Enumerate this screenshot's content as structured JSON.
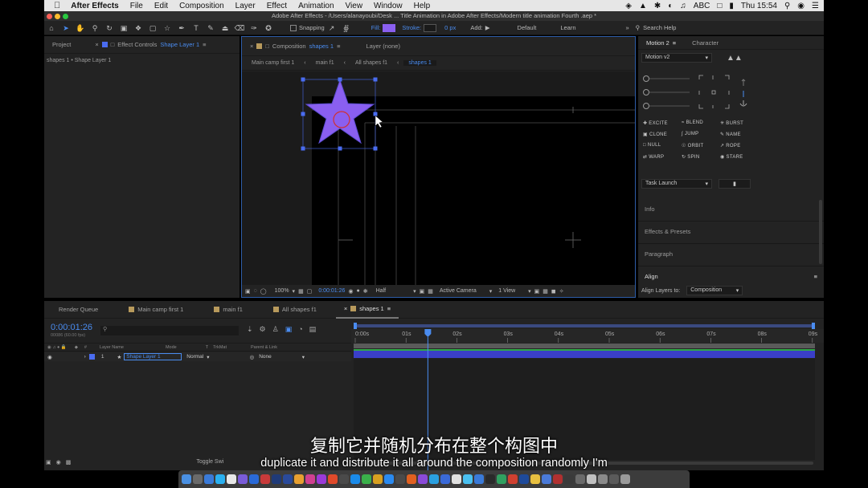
{
  "menubar": {
    "app": "After Effects",
    "items": [
      "File",
      "Edit",
      "Composition",
      "Layer",
      "Effect",
      "Animation",
      "View",
      "Window",
      "Help"
    ],
    "status": {
      "input": "ABC",
      "clock": "Thu 15:54"
    }
  },
  "window": {
    "title": "Adobe After Effects - /Users/alanayoubi/Desk ... Title Animation in Adobe After Effects/Modern title animation Fourth .aep *"
  },
  "toolbar": {
    "snapping": "Snapping",
    "fill_label": "Fill:",
    "fill_color": "#8a5ff0",
    "stroke_label": "Stroke:",
    "stroke_value": "0 px",
    "add_label": "Add:",
    "workspace_default": "Default",
    "workspace_learn": "Learn",
    "search_placeholder": "Search Help"
  },
  "project_panel": {
    "tab_project": "Project",
    "tab_effect_controls": "Effect Controls",
    "effect_layer": "Shape Layer 1",
    "breadcrumb": "shapes 1 • Shape Layer 1"
  },
  "comp_panel": {
    "tab_label": "Composition",
    "comp_name": "shapes 1",
    "layer_tab": "Layer (none)",
    "breadcrumbs": [
      "Main camp first 1",
      "main f1",
      "All shapes f1",
      "shapes 1"
    ],
    "footer": {
      "zoom": "100%",
      "timecode": "0:00:01:26",
      "resolution": "Half",
      "camera": "Active Camera",
      "views": "1 View"
    },
    "star_color": "#8a5ff0"
  },
  "motion_panel": {
    "tab_motion": "Motion 2",
    "tab_character": "Character",
    "version": "Motion v2",
    "effects": [
      [
        "EXCITE",
        "BLEND",
        "BURST"
      ],
      [
        "CLONE",
        "JUMP",
        "NAME"
      ],
      [
        "NULL",
        "ORBIT",
        "ROPE"
      ],
      [
        "WARP",
        "SPIN",
        "STARE"
      ]
    ],
    "task_launch": "Task Launch",
    "sections": [
      "Info",
      "Effects & Presets",
      "Paragraph",
      "Align"
    ],
    "align_layers_to_label": "Align Layers to:",
    "align_layers_to_value": "Composition"
  },
  "timeline": {
    "tabs": [
      "Render Queue",
      "Main camp first 1",
      "main f1",
      "All shapes f1",
      "shapes 1"
    ],
    "timecode": "0:00:01:26",
    "fps_text": "00086 (60.00 fps)",
    "search_placeholder": "",
    "headers": {
      "num": "#",
      "layer_name": "Layer Name",
      "mode": "Mode",
      "t": "T",
      "trkmat": "TrkMat",
      "parent": "Parent & Link"
    },
    "ruler": [
      "0:00s",
      "01s",
      "02s",
      "03s",
      "04s",
      "05s",
      "06s",
      "07s",
      "08s",
      "09s"
    ],
    "playhead_time": 1.43,
    "duration_seconds": 9.5,
    "layers": [
      {
        "num": "1",
        "name": "Shape Layer 1",
        "mode": "Normal",
        "parent": "None",
        "label_color": "#4a6cf0",
        "bar_color": "#3a3fc8"
      }
    ],
    "toggle_label": "Toggle Swi"
  },
  "subtitles": {
    "zh": "复制它并随机分布在整个构图中",
    "en": "duplicate it and distribute it all around the composition randomly I'm"
  }
}
